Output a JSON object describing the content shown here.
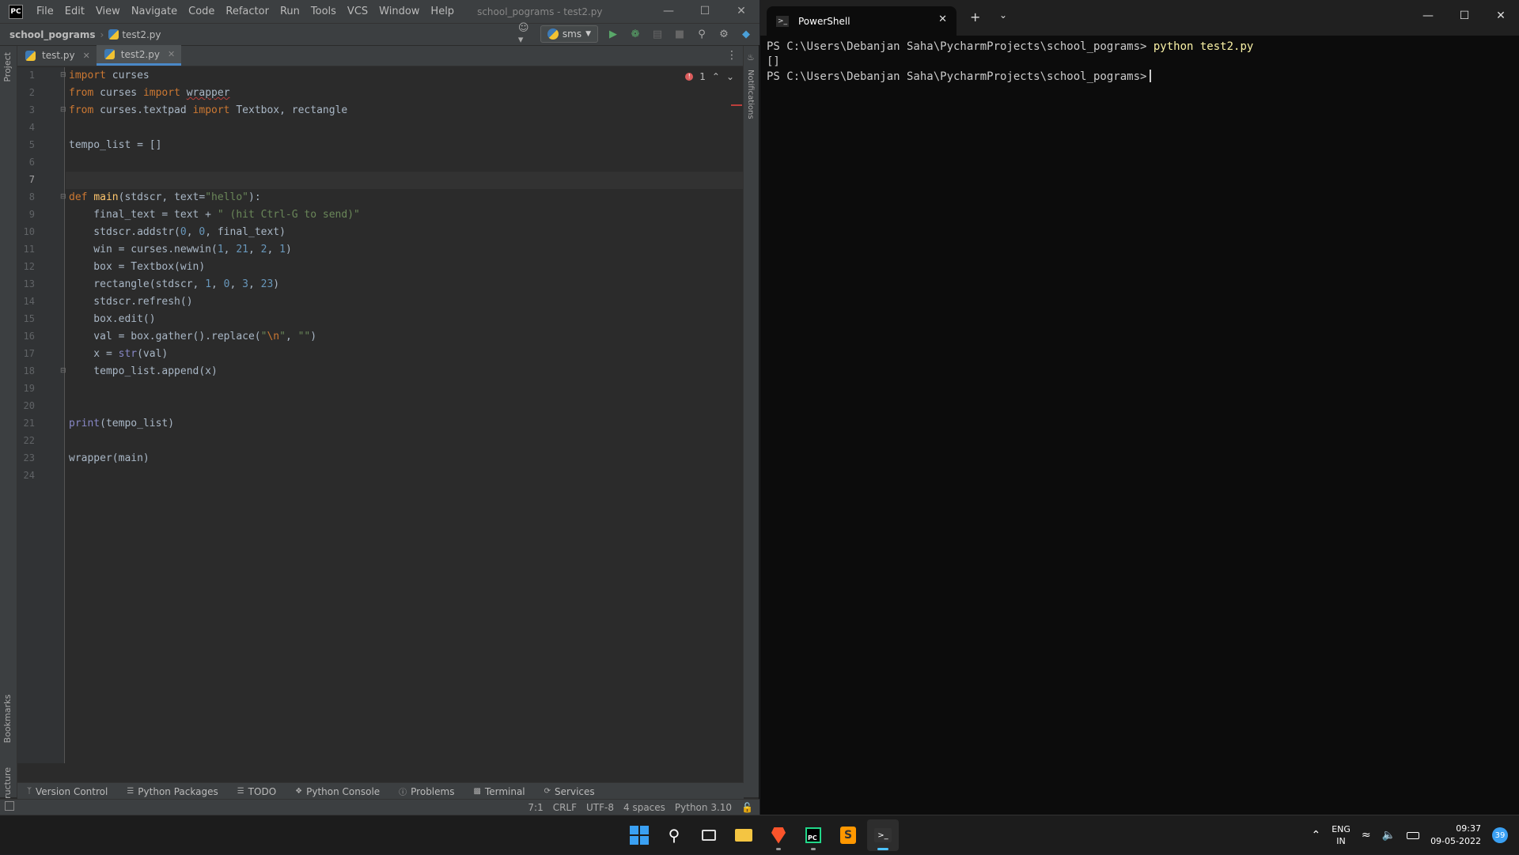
{
  "ide": {
    "logo": "PC",
    "menu": [
      "File",
      "Edit",
      "View",
      "Navigate",
      "Code",
      "Refactor",
      "Run",
      "Tools",
      "VCS",
      "Window",
      "Help"
    ],
    "window_title": "school_pograms - test2.py",
    "breadcrumb": {
      "project": "school_pograms",
      "file": "test2.py"
    },
    "run_config": "sms",
    "tabs": [
      {
        "label": "test.py",
        "active": false
      },
      {
        "label": "test2.py",
        "active": true
      }
    ],
    "left_tools": [
      "Project",
      "Bookmarks",
      "Structure"
    ],
    "right_tools": [
      "Notifications"
    ],
    "error_count": "1",
    "current_line": 7,
    "code_lines": 24,
    "tool_windows": [
      "Version Control",
      "Python Packages",
      "TODO",
      "Python Console",
      "Problems",
      "Terminal",
      "Services"
    ],
    "status": {
      "position": "7:1",
      "line_sep": "CRLF",
      "encoding": "UTF-8",
      "indent": "4 spaces",
      "interpreter": "Python 3.10"
    }
  },
  "terminal": {
    "tab_title": "PowerShell",
    "prompt": "PS C:\\Users\\Debanjan Saha\\PycharmProjects\\school_pograms>",
    "command": "python test2.py",
    "output": "[]"
  },
  "taskbar": {
    "apps": [
      "windows-start",
      "search",
      "task-view",
      "file-explorer",
      "brave-browser",
      "pycharm",
      "sublime-text",
      "windows-terminal"
    ],
    "lang_line1": "ENG",
    "lang_line2": "IN",
    "time": "09:37",
    "date": "09-05-2022",
    "notification_count": "39"
  },
  "colors": {
    "keyword": "#cc7832",
    "function": "#ffc66d",
    "string": "#6a8759",
    "number": "#6897bb",
    "accent": "#4a88c7"
  }
}
